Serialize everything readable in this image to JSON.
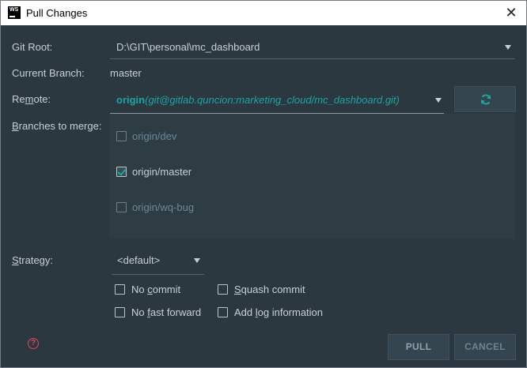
{
  "window": {
    "app_logo": "WS",
    "title": "Pull Changes",
    "close_glyph": "✕"
  },
  "form": {
    "git_root_label": "Git Root:",
    "git_root_value": "D:\\GIT\\personal\\mc_dashboard",
    "current_branch_label": "Current Branch:",
    "current_branch_value": "master",
    "remote_label": "Remote:",
    "remote_name": "origin",
    "remote_url": "(git@gitlab.quncion:marketing_cloud/mc_dashboard.git)",
    "branches_label": "Branches to merge:",
    "branches": [
      {
        "label": "origin/dev",
        "checked": false,
        "enabled": false
      },
      {
        "label": "origin/master",
        "checked": true,
        "enabled": true
      },
      {
        "label": "origin/wq-bug",
        "checked": false,
        "enabled": false
      }
    ],
    "strategy_label": "Strategy:",
    "strategy_value": "<default>",
    "options": {
      "no_commit": "No commit",
      "squash_commit": "Squash commit",
      "no_fast_forward": "No fast forward",
      "add_log_information": "Add log information"
    }
  },
  "buttons": {
    "pull": "PULL",
    "cancel": "CANCEL",
    "help": "?"
  },
  "icons": {
    "refresh": "refresh-icon",
    "help": "help-icon",
    "dropdown": "chevron-down-icon"
  },
  "colors": {
    "background": "#2b3840",
    "accent": "#1ea5a0",
    "help": "#e0465a"
  }
}
